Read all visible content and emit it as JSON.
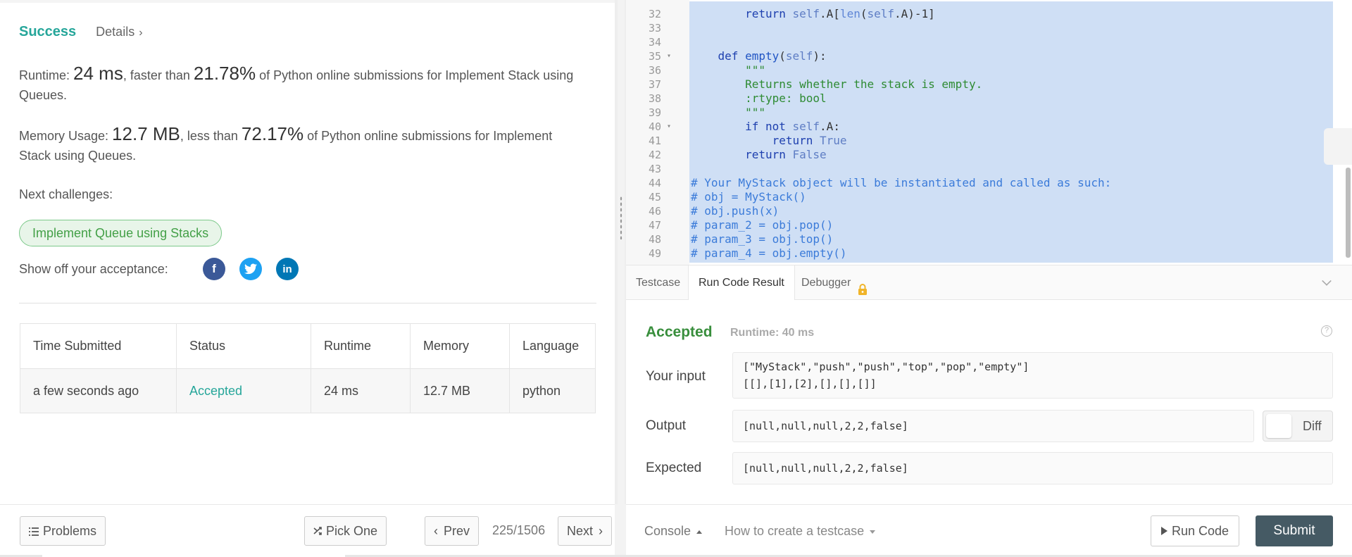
{
  "left": {
    "status": "Success",
    "details_label": "Details",
    "runtime": {
      "label": "Runtime: ",
      "value": "24 ms",
      "mid": ", faster than ",
      "percent": "21.78%",
      "tail": " of Python online submissions for Implement Stack using Queues."
    },
    "memory": {
      "label": "Memory Usage: ",
      "value": "12.7 MB",
      "mid": ", less than ",
      "percent": "72.17%",
      "tail": " of Python online submissions for Implement Stack using Queues."
    },
    "next_challenges_label": "Next challenges:",
    "next_challenge": "Implement Queue using Stacks",
    "show_off_label": "Show off your acceptance:",
    "social": [
      "f",
      "t",
      "in"
    ],
    "table": {
      "headers": [
        "Time Submitted",
        "Status",
        "Runtime",
        "Memory",
        "Language"
      ],
      "row": [
        "a few seconds ago",
        "Accepted",
        "24 ms",
        "12.7 MB",
        "python"
      ]
    }
  },
  "editor": {
    "lines": [
      {
        "n": "32",
        "fold": "",
        "code": [
          [
            "",
            "        "
          ],
          [
            "kw",
            "return"
          ],
          [
            "",
            " "
          ],
          [
            "self",
            "self"
          ],
          [
            "",
            ".A["
          ],
          [
            "bi",
            "len"
          ],
          [
            "",
            "("
          ],
          [
            "self",
            "self"
          ],
          [
            "",
            ".A)-1]"
          ]
        ]
      },
      {
        "n": "33",
        "fold": "",
        "code": []
      },
      {
        "n": "34",
        "fold": "",
        "code": []
      },
      {
        "n": "35",
        "fold": "▾",
        "code": [
          [
            "",
            "    "
          ],
          [
            "kw",
            "def"
          ],
          [
            "",
            " "
          ],
          [
            "kw2",
            "empty"
          ],
          [
            "",
            "("
          ],
          [
            "self",
            "self"
          ],
          [
            "",
            "):"
          ]
        ]
      },
      {
        "n": "36",
        "fold": "",
        "code": [
          [
            "",
            "        "
          ],
          [
            "str",
            "\"\"\""
          ]
        ]
      },
      {
        "n": "37",
        "fold": "",
        "code": [
          [
            "",
            "        "
          ],
          [
            "str",
            "Returns whether the stack is empty."
          ]
        ]
      },
      {
        "n": "38",
        "fold": "",
        "code": [
          [
            "",
            "        "
          ],
          [
            "str",
            ":rtype: bool"
          ]
        ]
      },
      {
        "n": "39",
        "fold": "",
        "code": [
          [
            "",
            "        "
          ],
          [
            "str",
            "\"\"\""
          ]
        ]
      },
      {
        "n": "40",
        "fold": "▾",
        "code": [
          [
            "",
            "        "
          ],
          [
            "kw",
            "if"
          ],
          [
            "",
            " "
          ],
          [
            "kw",
            "not"
          ],
          [
            "",
            " "
          ],
          [
            "self",
            "self"
          ],
          [
            "",
            ".A:"
          ]
        ]
      },
      {
        "n": "41",
        "fold": "",
        "code": [
          [
            "",
            "            "
          ],
          [
            "kw",
            "return"
          ],
          [
            "",
            " "
          ],
          [
            "self",
            "True"
          ]
        ]
      },
      {
        "n": "42",
        "fold": "",
        "code": [
          [
            "",
            "        "
          ],
          [
            "kw",
            "return"
          ],
          [
            "",
            " "
          ],
          [
            "self",
            "False"
          ]
        ]
      },
      {
        "n": "43",
        "fold": "",
        "code": []
      },
      {
        "n": "44",
        "fold": "",
        "code": [
          [
            "com",
            "# Your MyStack object will be instantiated and called as such:"
          ]
        ]
      },
      {
        "n": "45",
        "fold": "",
        "code": [
          [
            "com",
            "# obj = MyStack()"
          ]
        ]
      },
      {
        "n": "46",
        "fold": "",
        "code": [
          [
            "com",
            "# obj.push(x)"
          ]
        ]
      },
      {
        "n": "47",
        "fold": "",
        "code": [
          [
            "com",
            "# param_2 = obj.pop()"
          ]
        ]
      },
      {
        "n": "48",
        "fold": "",
        "code": [
          [
            "com",
            "# param_3 = obj.top()"
          ]
        ]
      },
      {
        "n": "49",
        "fold": "",
        "code": [
          [
            "com",
            "# param_4 = obj.empty()"
          ]
        ]
      }
    ]
  },
  "tabs": {
    "testcase": "Testcase",
    "run_code_result": "Run Code Result",
    "debugger": "Debugger"
  },
  "result": {
    "status": "Accepted",
    "runtime": "Runtime: 40 ms",
    "your_input_label": "Your input",
    "input_line1": "[\"MyStack\",\"push\",\"push\",\"top\",\"pop\",\"empty\"]",
    "input_line2": "[[],[1],[2],[],[],[]]",
    "output_label": "Output",
    "output": "[null,null,null,2,2,false]",
    "expected_label": "Expected",
    "expected": "[null,null,null,2,2,false]",
    "diff_label": "Diff"
  },
  "bottom": {
    "problems": "Problems",
    "pick_one": "Pick One",
    "prev": "Prev",
    "page": "225/1506",
    "next": "Next",
    "console": "Console",
    "how_to": "How to create a testcase",
    "run_code": "Run Code",
    "submit": "Submit"
  },
  "colors": {
    "success": "#26a69a",
    "accepted_result": "#388e3c",
    "submit_bg": "#455a64",
    "selection": "#cfdff5"
  }
}
